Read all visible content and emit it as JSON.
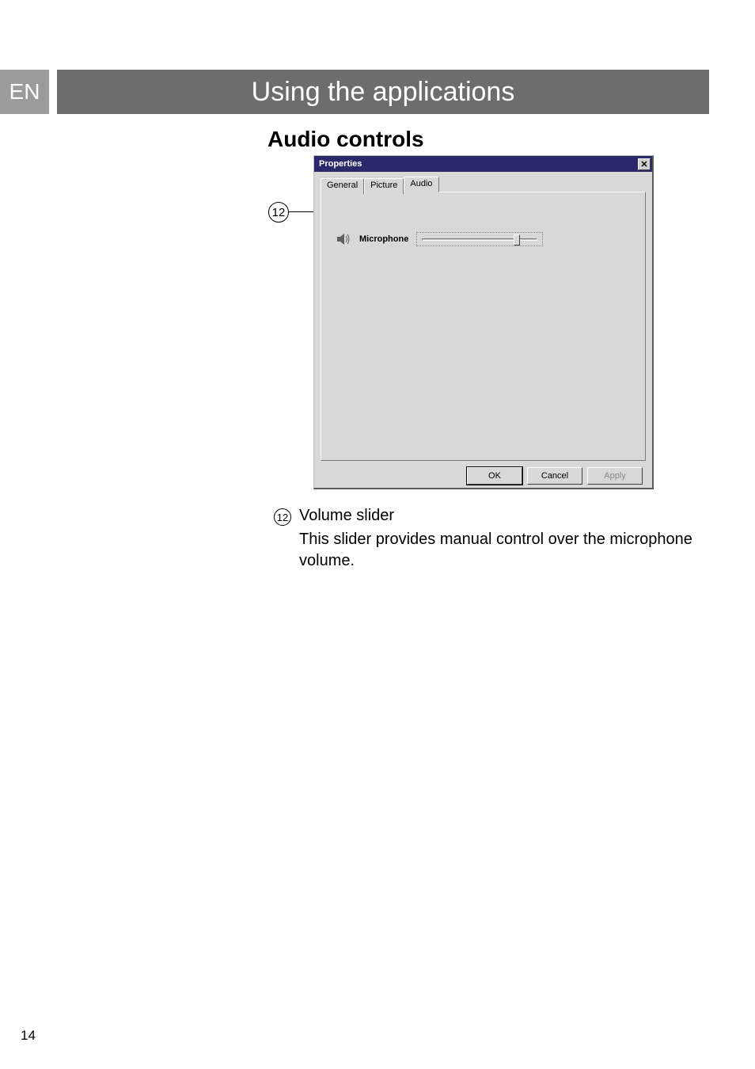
{
  "lang": "EN",
  "header": "Using the applications",
  "section_title": "Audio controls",
  "callout_number": "12",
  "dialog": {
    "title": "Properties",
    "tabs": {
      "general": "General",
      "picture": "Picture",
      "audio": "Audio"
    },
    "microphone_label": "Microphone",
    "slider_value_percent": 80,
    "buttons": {
      "ok": "OK",
      "cancel": "Cancel",
      "apply": "Apply"
    }
  },
  "description": {
    "number": "12",
    "title": "Volume slider",
    "text": "This slider provides manual control over the microphone volume."
  },
  "page_number": "14"
}
